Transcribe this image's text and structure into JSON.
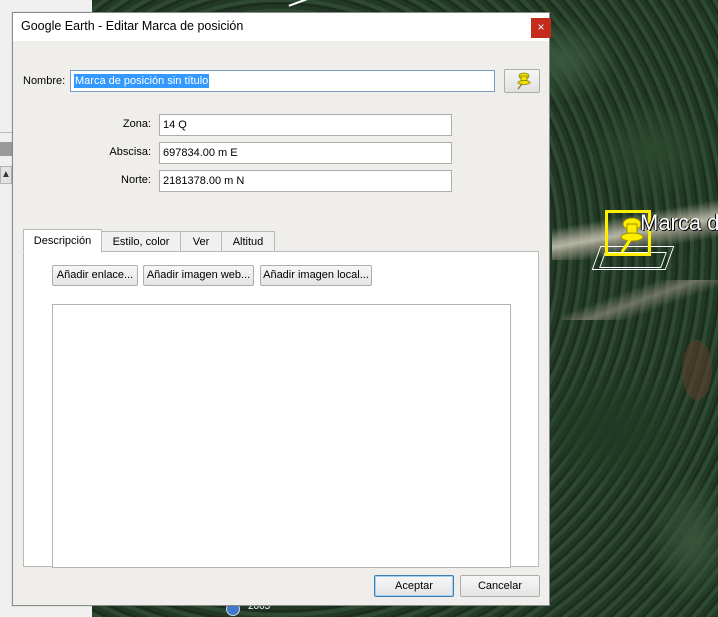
{
  "window": {
    "title": "Google Earth - Editar Marca de posición",
    "close_glyph": "×"
  },
  "form": {
    "name_label": "Nombre:",
    "name_value": "Marca de posición sin título",
    "pin_icon": "yellow-pushpin-icon",
    "zone_label": "Zona:",
    "zone_value": "14 Q",
    "easting_label": "Abscisa:",
    "easting_value": "697834.00 m E",
    "northing_label": "Norte:",
    "northing_value": "2181378.00 m N"
  },
  "tabs": [
    {
      "label": "Descripción",
      "active": true
    },
    {
      "label": "Estilo, color",
      "active": false
    },
    {
      "label": "Ver",
      "active": false
    },
    {
      "label": "Altitud",
      "active": false
    }
  ],
  "description": {
    "add_link": "Añadir enlace...",
    "add_web_image": "Añadir imagen web...",
    "add_local_image": "Añadir imagen local...",
    "text": ""
  },
  "buttons": {
    "accept": "Aceptar",
    "cancel": "Cancelar"
  },
  "map": {
    "placemark_label": "Marca d",
    "year": "2005",
    "accent_color": "#ffee00"
  },
  "colors": {
    "selection": "#3399ff",
    "close": "#c42b1c",
    "dialog_bg": "#f0eeea"
  }
}
